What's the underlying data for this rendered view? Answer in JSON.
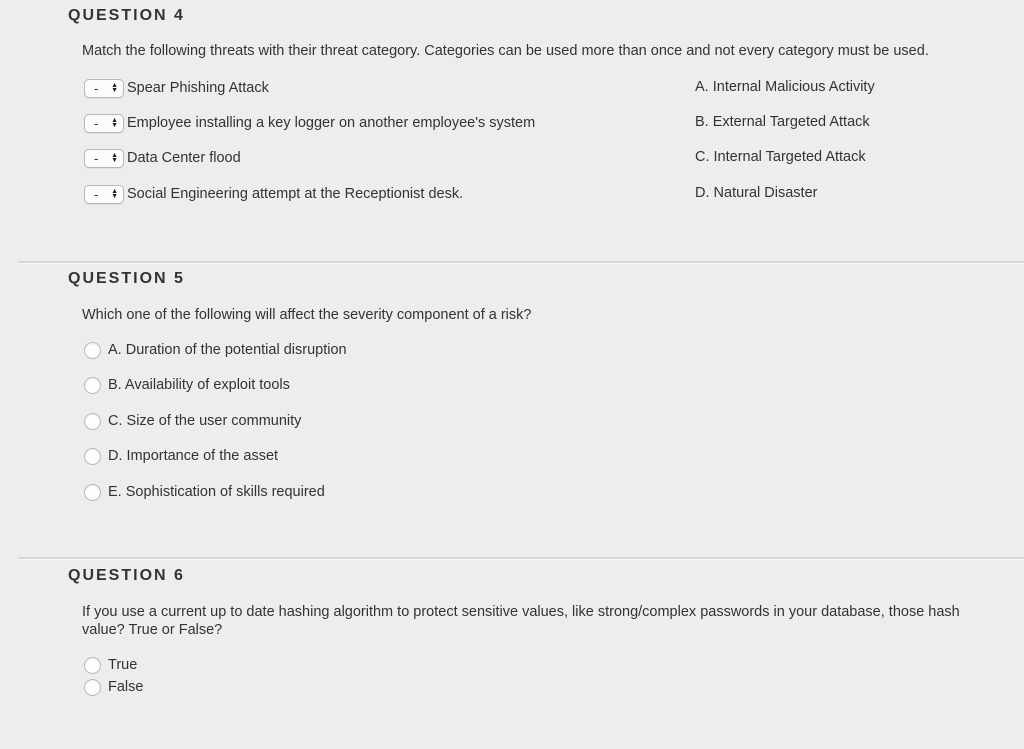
{
  "questions": [
    {
      "title": "QUESTION 4",
      "prompt": "Match the following threats with their threat category. Categories can be used more than once and not every category must be used.",
      "matches": [
        {
          "select_value": "-",
          "label": "Spear Phishing Attack"
        },
        {
          "select_value": "-",
          "label": "Employee installing a key logger on another employee's system"
        },
        {
          "select_value": "-",
          "label": "Data Center flood"
        },
        {
          "select_value": "-",
          "label": "Social Engineering attempt at the Receptionist desk."
        }
      ],
      "categories": [
        "A. Internal Malicious Activity",
        "B. External Targeted Attack",
        "C. Internal Targeted Attack",
        "D. Natural Disaster"
      ]
    },
    {
      "title": "QUESTION 5",
      "prompt": "Which one of the following will affect the severity component of a risk?",
      "options": [
        "A. Duration of the potential disruption",
        "B. Availability of exploit tools",
        "C. Size of the user community",
        "D. Importance of the asset",
        "E. Sophistication of skills required"
      ]
    },
    {
      "title": "QUESTION 6",
      "prompt_line1": "If you use a current up to date hashing algorithm to protect sensitive values, like strong/complex passwords in your database, those hash",
      "prompt_line2": "value? True or False?",
      "options": [
        "True",
        "False"
      ]
    }
  ]
}
